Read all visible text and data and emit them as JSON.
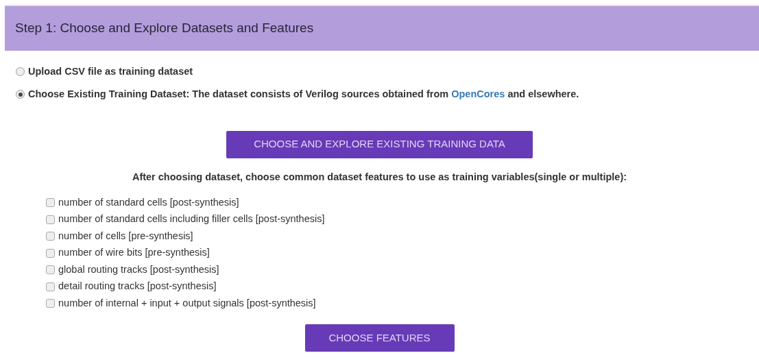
{
  "header": {
    "title": "Step 1: Choose and Explore Datasets and Features"
  },
  "dataset_options": [
    {
      "label": "Upload CSV file as training dataset",
      "selected": false
    },
    {
      "label": "Choose Existing Training Dataset: The dataset consists of Verilog sources obtained from ",
      "link": "OpenCores",
      "label_after": " and elsewhere.",
      "selected": true
    }
  ],
  "explore_button": "CHOOSE AND EXPLORE EXISTING TRAINING DATA",
  "features_heading": "After choosing dataset, choose common dataset features to use as training variables(single or multiple):",
  "features": [
    {
      "label": "number of standard cells [post-synthesis]",
      "checked": false
    },
    {
      "label": "number of standard cells including filler cells [post-synthesis]",
      "checked": false
    },
    {
      "label": "number of cells [pre-synthesis]",
      "checked": false
    },
    {
      "label": "number of wire bits [pre-synthesis]",
      "checked": false
    },
    {
      "label": "global routing tracks [post-synthesis]",
      "checked": false
    },
    {
      "label": "detail routing tracks [post-synthesis]",
      "checked": false
    },
    {
      "label": "number of internal + input + output signals [post-synthesis]",
      "checked": false
    }
  ],
  "features_button": "CHOOSE FEATURES"
}
